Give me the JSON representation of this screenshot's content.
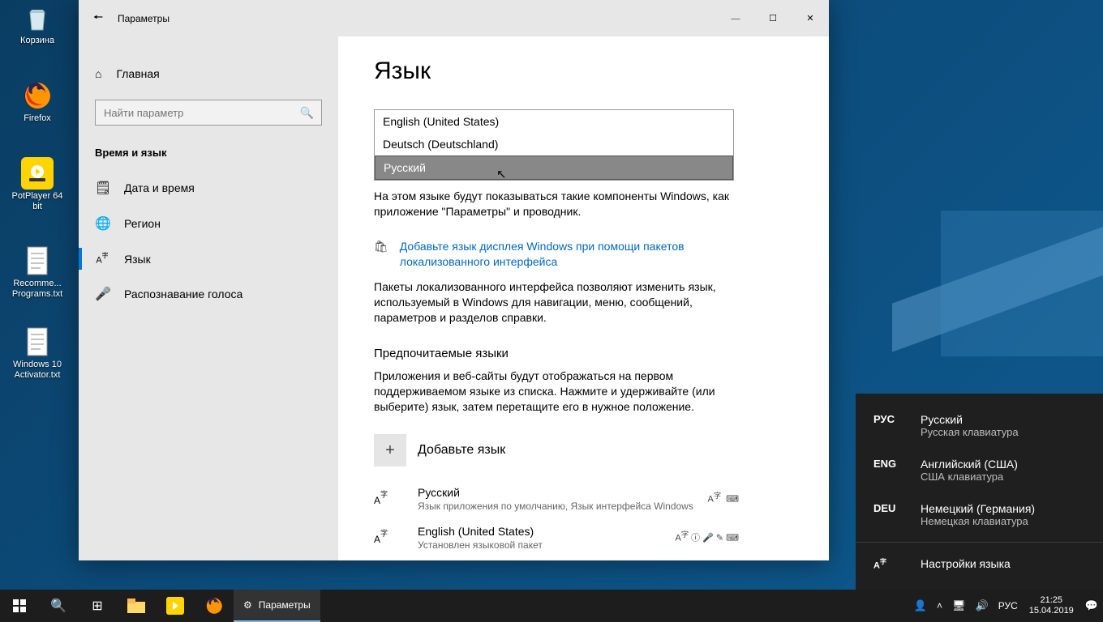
{
  "desktop": {
    "icons": [
      {
        "label": "Корзина"
      },
      {
        "label": "Firefox"
      },
      {
        "label": "PotPlayer 64 bit"
      },
      {
        "label": "Recomme... Programs.txt"
      },
      {
        "label": "Windows 10 Activator.txt"
      }
    ]
  },
  "window": {
    "title": "Параметры",
    "sidebar": {
      "home": "Главная",
      "search_placeholder": "Найти параметр",
      "section": "Время и язык",
      "items": [
        {
          "label": "Дата и время"
        },
        {
          "label": "Регион"
        },
        {
          "label": "Язык"
        },
        {
          "label": "Распознавание голоса"
        }
      ]
    },
    "content": {
      "heading": "Язык",
      "langbox": [
        "English (United States)",
        "Deutsch (Deutschland)",
        "Русский"
      ],
      "desc1": "На этом языке будут показываться такие компоненты Windows, как приложение \"Параметры\" и проводник.",
      "link1": "Добавьте язык дисплея Windows при помощи пакетов локализованного интерфейса",
      "desc2": "Пакеты локализованного интерфейса позволяют изменить язык, используемый в Windows для навигации, меню, сообщений, параметров и разделов справки.",
      "subhead": "Предпочитаемые языки",
      "desc3": "Приложения и веб-сайты будут отображаться на первом поддерживаемом языке из списка. Нажмите и удерживайте (или выберите) язык, затем перетащите его в нужное положение.",
      "addlang": "Добавьте язык",
      "langs": [
        {
          "name": "Русский",
          "sub": "Язык приложения по умолчанию, Язык интерфейса Windows"
        },
        {
          "name": "English (United States)",
          "sub": "Установлен языковой пакет"
        }
      ]
    }
  },
  "langflyout": [
    {
      "code": "РУС",
      "name": "Русский",
      "sub": "Русская клавиатура"
    },
    {
      "code": "ENG",
      "name": "Английский (США)",
      "sub": "США клавиатура"
    },
    {
      "code": "DEU",
      "name": "Немецкий (Германия)",
      "sub": "Немецкая клавиатура"
    }
  ],
  "langflyout_settings": "Настройки языка",
  "taskbar": {
    "running": "Параметры",
    "lang": "РУС",
    "time": "21:25",
    "date": "15.04.2019"
  }
}
